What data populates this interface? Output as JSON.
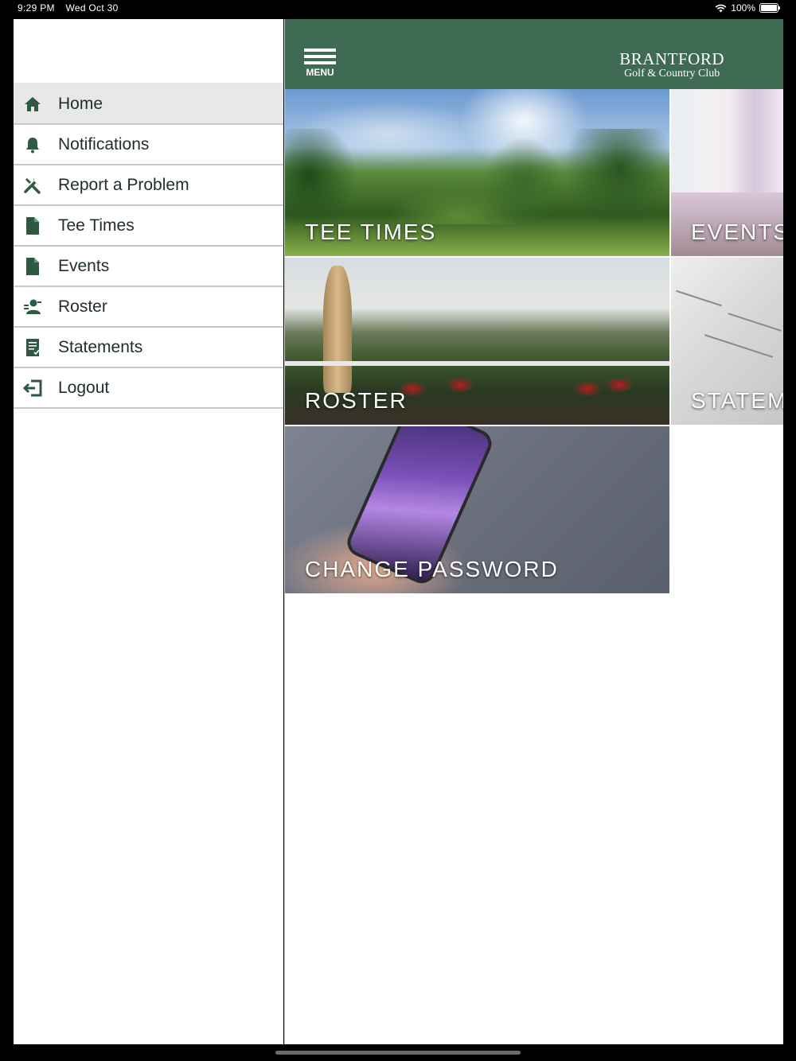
{
  "status_bar": {
    "time": "9:29 PM",
    "date": "Wed Oct 30",
    "battery": "100%",
    "wifi_icon": "wifi-icon",
    "battery_icon": "battery-icon"
  },
  "sidebar": {
    "items": [
      {
        "label": "Home",
        "icon": "home-icon",
        "active": true
      },
      {
        "label": "Notifications",
        "icon": "bell-icon"
      },
      {
        "label": "Report a Problem",
        "icon": "tools-icon"
      },
      {
        "label": "Tee Times",
        "icon": "document-icon"
      },
      {
        "label": "Events",
        "icon": "document-icon"
      },
      {
        "label": "Roster",
        "icon": "user-list-icon"
      },
      {
        "label": "Statements",
        "icon": "statement-icon"
      },
      {
        "label": "Logout",
        "icon": "logout-icon"
      }
    ]
  },
  "header": {
    "menu_label": "MENU",
    "logo_line1": "BRANTFORD",
    "logo_line2": "Golf & Country Club"
  },
  "tiles": {
    "tee_times": "TEE TIMES",
    "events": "EVENTS",
    "roster": "ROSTER",
    "statements": "STATEM",
    "change_password": "CHANGE PASSWORD"
  },
  "colors": {
    "header_green": "#3f6a54",
    "icon_green": "#2e5a43",
    "active_item_bg": "#e8e8e8"
  }
}
